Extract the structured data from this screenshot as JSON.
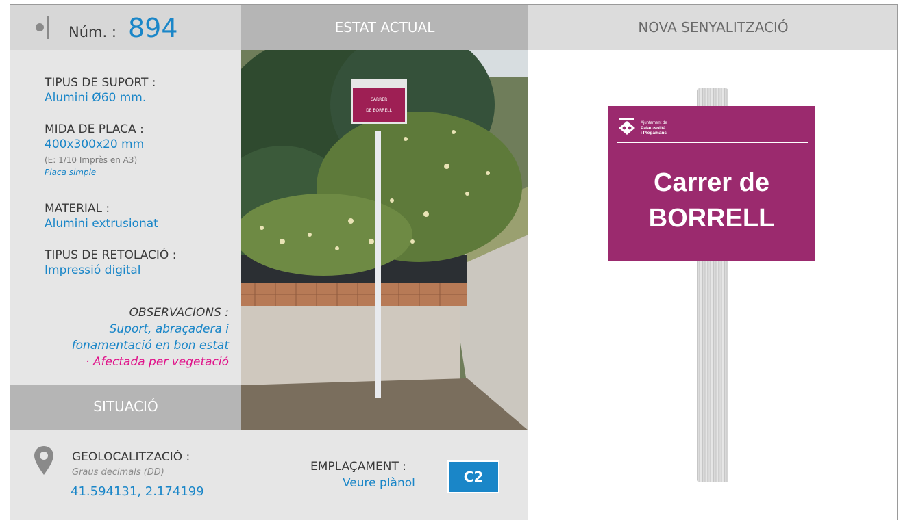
{
  "colors": {
    "accent_blue": "#1a86c8",
    "alert_pink": "#e0148a",
    "sign_purple": "#9b2a6e",
    "header_dark": "#b5b5b5",
    "panel_light": "#e6e6e6"
  },
  "header": {
    "num_label": "Núm. :",
    "num_value": "894",
    "estat_actual": "ESTAT ACTUAL",
    "nova_senyalitzacio": "NOVA SENYALITZACIÓ"
  },
  "fields": {
    "tipus_suport": {
      "label": "TIPUS DE SUPORT :",
      "value": "Alumini Ø60 mm."
    },
    "mida_placa": {
      "label": "MIDA DE PLACA :",
      "value": "400x300x20 mm",
      "note": "(E: 1/10 Imprès en A3)",
      "type": "Placa simple"
    },
    "material": {
      "label": "MATERIAL :",
      "value": "Alumini extrusionat"
    },
    "retolacio": {
      "label": "TIPUS DE RETOLACIÓ :",
      "value": "Impressió digital"
    }
  },
  "observacions": {
    "label": "OBSERVACIONS :",
    "line1": "Suport, abraçadera i",
    "line2": "fonamentació en bon estat",
    "alert": "· Afectada per vegetació"
  },
  "situacio": {
    "title": "SITUACIÓ",
    "geo_label": "GEOLOCALITZACIÓ :",
    "geo_format": "Graus decimals (DD)",
    "geo_value": "41.594131, 2.174199",
    "empl_label": "EMPLAÇAMENT :",
    "empl_link": "Veure plànol",
    "empl_code": "C2"
  },
  "photo": {
    "sign_line1": "CARRER",
    "sign_line2": "DE BORRELL"
  },
  "new_sign": {
    "org_line1": "Ajuntament de",
    "org_line2": "Palau-solità",
    "org_line3": "i Plegamans",
    "street_line1": "Carrer de",
    "street_line2": "BORRELL"
  },
  "icons": {
    "marker": "location-marker-icon",
    "pin": "map-pin-icon",
    "logo": "town-crest-icon"
  }
}
